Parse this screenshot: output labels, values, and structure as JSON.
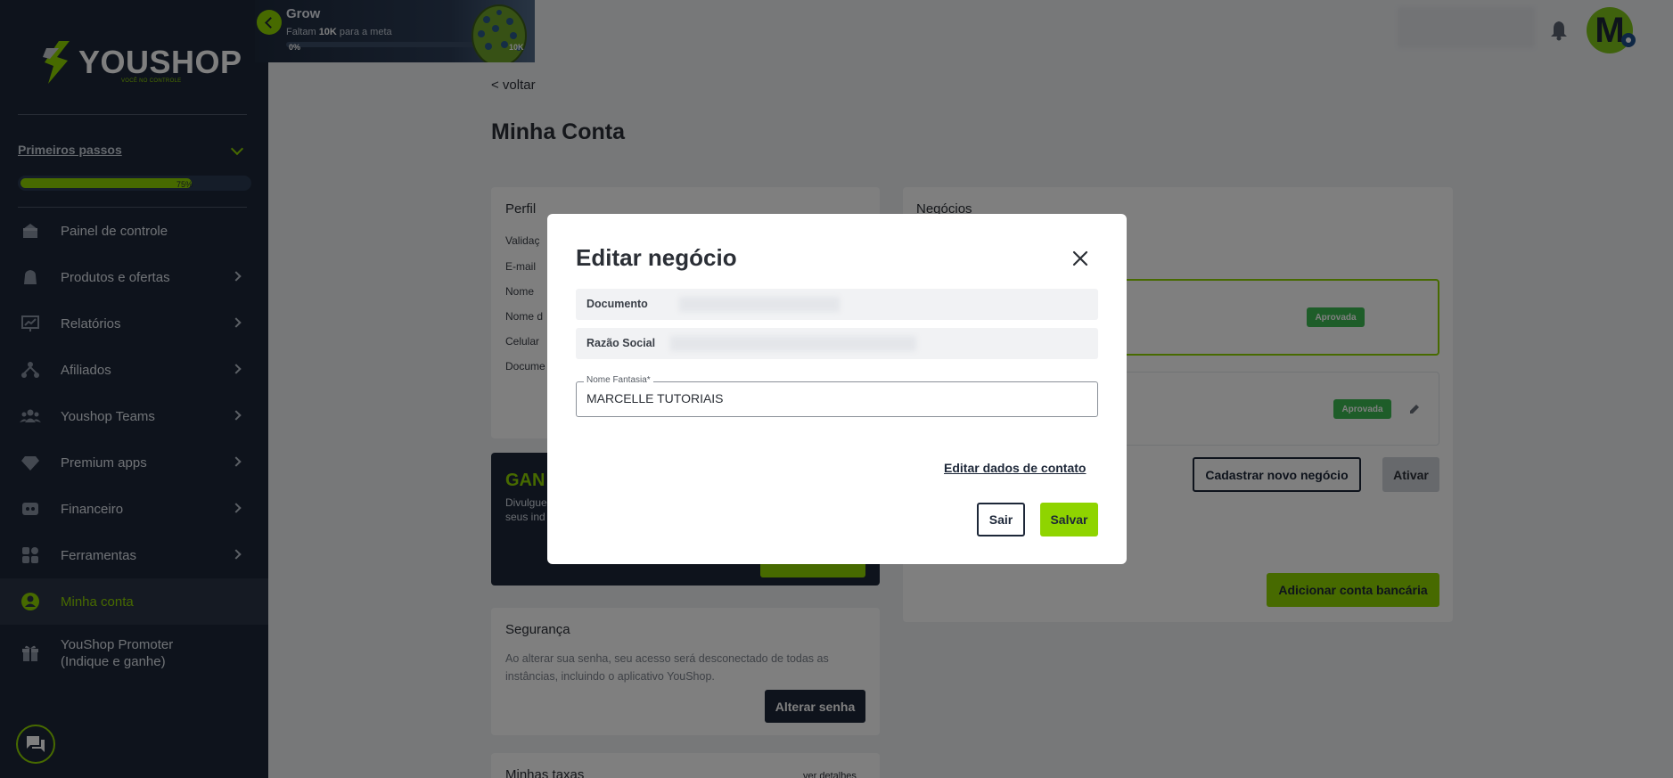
{
  "sidebar": {
    "logo_text": "YOUSHOP",
    "logo_tagline": "VOCÊ NO CONTROLE",
    "steps_label": "Primeiros passos",
    "steps_progress_text": "75%",
    "steps_progress_fraction": 0.75,
    "items": [
      {
        "label": "Painel de controle",
        "icon": "store-icon",
        "has_arrow": false
      },
      {
        "label": "Produtos e ofertas",
        "icon": "bag-icon",
        "has_arrow": true
      },
      {
        "label": "Relatórios",
        "icon": "chart-board-icon",
        "has_arrow": true
      },
      {
        "label": "Afiliados",
        "icon": "network-icon",
        "has_arrow": true
      },
      {
        "label": "Youshop Teams",
        "icon": "team-icon",
        "has_arrow": true
      },
      {
        "label": "Premium apps",
        "icon": "diamond-icon",
        "has_arrow": true
      },
      {
        "label": "Financeiro",
        "icon": "wallet-icon",
        "has_arrow": true
      },
      {
        "label": "Ferramentas",
        "icon": "grid-icon",
        "has_arrow": true
      },
      {
        "label": "Minha conta",
        "icon": "user-circle-icon",
        "has_arrow": false,
        "active": true
      },
      {
        "label": "YouShop Promoter\n(Indique e ganhe)",
        "icon": "gift-icon",
        "has_arrow": false
      }
    ]
  },
  "grow": {
    "title": "Grow",
    "subtitle_prefix": "Faltam ",
    "subtitle_value": "10K",
    "subtitle_suffix": " para a meta",
    "start_label": "0%",
    "end_label": "10K"
  },
  "header": {
    "avatar_letter": "M"
  },
  "main": {
    "back_label": "< voltar",
    "title": "Minha Conta",
    "perfil": {
      "title": "Perfil",
      "labels": [
        "Validaç",
        "E-mail",
        "Nome",
        "Nome d",
        "Celular",
        "Docume"
      ]
    },
    "promo": {
      "title": "GAN",
      "text": "Divulgue seus ind"
    },
    "seguranca": {
      "title": "Segurança",
      "text": "Ao alterar sua senha, seu acesso será desconectado de todas as instâncias, incluindo o aplicativo YouShop.",
      "button": "Alterar senha"
    },
    "taxas": {
      "title": "Minhas taxas",
      "link": "ver detalhes"
    },
    "negocios": {
      "title": "Negócios",
      "badge_1": "Aprovada",
      "badge_2": "Aprovada",
      "new_button": "Cadastrar novo negócio",
      "activate_button": "Ativar",
      "bank_button": "Adicionar conta bancária"
    }
  },
  "modal": {
    "title": "Editar negócio",
    "documento_label": "Documento",
    "razao_label": "Razão Social",
    "nome_fantasia_label": "Nome Fantasia*",
    "nome_fantasia_value": "MARCELLE TUTORIAIS",
    "contact_link": "Editar dados de contato",
    "cancel_button": "Sair",
    "save_button": "Salvar"
  },
  "colors": {
    "accent": "#8fd400",
    "sidebar_bg": "#1d2738",
    "approved": "#3cba52"
  }
}
